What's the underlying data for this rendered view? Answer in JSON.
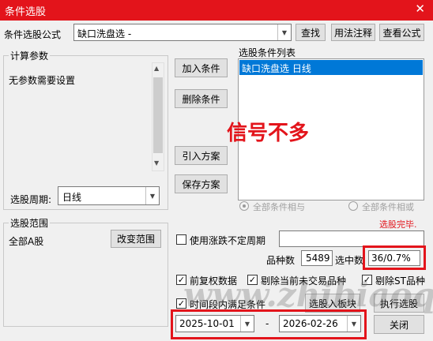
{
  "window": {
    "title": "条件选股",
    "close_glyph": "✕"
  },
  "formula": {
    "label": "条件选股公式",
    "value": "缺口洗盘选  -",
    "find_btn": "查找",
    "usage_btn": "用法注释",
    "view_btn": "查看公式"
  },
  "params": {
    "group_label": "计算参数",
    "empty_text": "无参数需要设置",
    "period_label": "选股周期:",
    "period_value": "日线"
  },
  "actions": {
    "add": "加入条件",
    "remove": "删除条件",
    "import": "引入方案",
    "save": "保存方案"
  },
  "conditions": {
    "label": "选股条件列表",
    "items": [
      "缺口洗盘选  日线"
    ],
    "logic_and": "全部条件相与",
    "logic_or": "全部条件相或",
    "logic_selected": "and"
  },
  "overlay": {
    "text": "信号不多"
  },
  "status": {
    "done": "选股完毕."
  },
  "range": {
    "group_label": "选股范围",
    "value": "全部A股",
    "change_btn": "改变范围"
  },
  "options": {
    "var_period_label": "使用涨跌不定周期",
    "var_period_checked": false,
    "count_label": "品种数",
    "count_value": "5489",
    "hit_label": "选中数",
    "hit_value": "36/0.7%",
    "pre_adjust": "前复权数据",
    "pre_adjust_checked": true,
    "exclude_untraded": "剔除当前未交易品种",
    "exclude_untraded_checked": true,
    "exclude_st": "剔除ST品种",
    "exclude_st_checked": true,
    "time_satisfy": "时间段内满足条件",
    "time_satisfy_checked": true,
    "to_board_btn": "选股入板块",
    "execute_btn": "执行选股",
    "close_btn": "关闭",
    "date_start": "2025-10-01",
    "date_sep": "-",
    "date_end": "2026-02-26"
  },
  "watermark": "www.zhibiaoqi.com",
  "colors": {
    "title_bar": "#e3141b",
    "selection": "#0078d7",
    "highlight": "#e3141b"
  }
}
